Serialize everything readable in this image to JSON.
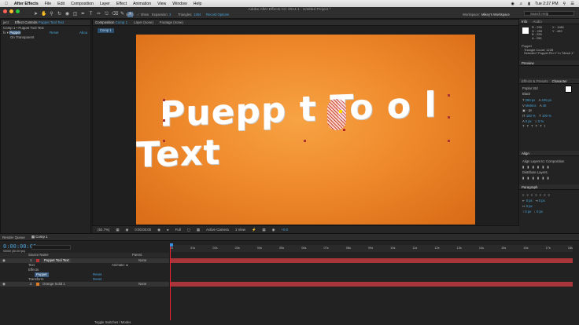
{
  "menubar": {
    "apple": "",
    "items": [
      "After Effects",
      "File",
      "Edit",
      "Composition",
      "Layer",
      "Effect",
      "Animation",
      "View",
      "Window",
      "Help"
    ],
    "clock": "Tue 2:27 PM"
  },
  "titlebar": {
    "title": "Adobe After Effects CC 2014.1 - Untitled Project *",
    "mesh_label": "Mesh:",
    "show_label": "Show",
    "expansion_label": "Expansion:",
    "expansion_value": "3",
    "triangles_label": "Triangles:",
    "triangles_value": "1264",
    "record_label": "Record Options",
    "workspace_label": "Workspace:",
    "workspace_value": "Mikey's Workspace",
    "search_placeholder": "Search Help"
  },
  "left_panel": {
    "tab_project": "ject",
    "tab_effects": "Effect Controls",
    "tab_layer": "Puppet Tool Text",
    "breadcrumb": "Comp 1 • Puppet Tool Text",
    "rows": [
      {
        "label": "Puppet",
        "reset": "Reset",
        "about": "Abou"
      },
      {
        "label": "On Transparent"
      }
    ]
  },
  "comp_panel": {
    "tab_comp": "Composition",
    "tab_comp_name": "Comp 1",
    "tab_layer": "Layer (none)",
    "tab_footage": "Footage (none)",
    "comp_chip": "Comp 1",
    "canvas_text": "Puppt Tool Text",
    "canvas_text_display": "Puepp t To o l Text"
  },
  "viewer_bar": {
    "zoom": "(62.7%)",
    "timecode": "0:00:00:00",
    "resolution": "Full",
    "camera": "Active Camera",
    "views": "1 View",
    "offset": "+0.0"
  },
  "info_panel": {
    "tab_info": "Info",
    "tab_audio": "Audio",
    "r": "R : 255",
    "g": "G : 255",
    "b": "B : 255",
    "a": "A : 255",
    "x": "X : 1188",
    "y": "Y : 459",
    "puppet": "Puppet",
    "triangle_count": "Triangle Count: 1228",
    "selected": "Selected \"Puppet Pin 1\" in \"Mesh 1\""
  },
  "preview_panel": {
    "title": "Preview"
  },
  "character_panel": {
    "tab_effects": "Effects & Presets",
    "tab_char": "Character",
    "font": "Poplar Std",
    "style": "Black",
    "size": "280 px",
    "leading": "420 px",
    "kerning": "Metrics",
    "tracking": "40",
    "stroke": "- px",
    "scale_v": "100 %",
    "scale_h": "100 %",
    "baseline": "0 px",
    "tsume": "0 %"
  },
  "align_panel": {
    "title": "Align",
    "align_to_label": "Align Layers to:",
    "align_to": "Composition",
    "distribute": "Distribute Layers:"
  },
  "paragraph_panel": {
    "title": "Paragraph",
    "v1": "0 px",
    "v2": "0 px",
    "v3": "0 px",
    "v4": "0 px",
    "v5": "0 px"
  },
  "timeline": {
    "tab_render": "Render Queue",
    "tab_comp": "Comp 1",
    "timecode": "0:00:00:00",
    "frames": "00000 (30.00 fps)",
    "col_source": "Source Name",
    "col_parent": "Parent",
    "layers": [
      {
        "num": "1",
        "name": "Puppet Tool Text",
        "mode": "None"
      },
      {
        "label": "Text",
        "extra": "Animate: ●"
      },
      {
        "label": "Effects"
      },
      {
        "label": "Puppet",
        "extra": "Reset"
      },
      {
        "label": "Transform",
        "extra": "Reset"
      },
      {
        "num": "2",
        "name": "Orange Solid 1",
        "mode": "None"
      }
    ],
    "ruler": [
      "0s",
      "01s",
      "02s",
      "03s",
      "04s",
      "05s",
      "06s",
      "07s",
      "08s",
      "09s",
      "10s",
      "11s",
      "12s",
      "13s",
      "14s",
      "15s",
      "16s",
      "17s",
      "18s"
    ],
    "toggle_label": "Toggle Switches / Modes"
  }
}
